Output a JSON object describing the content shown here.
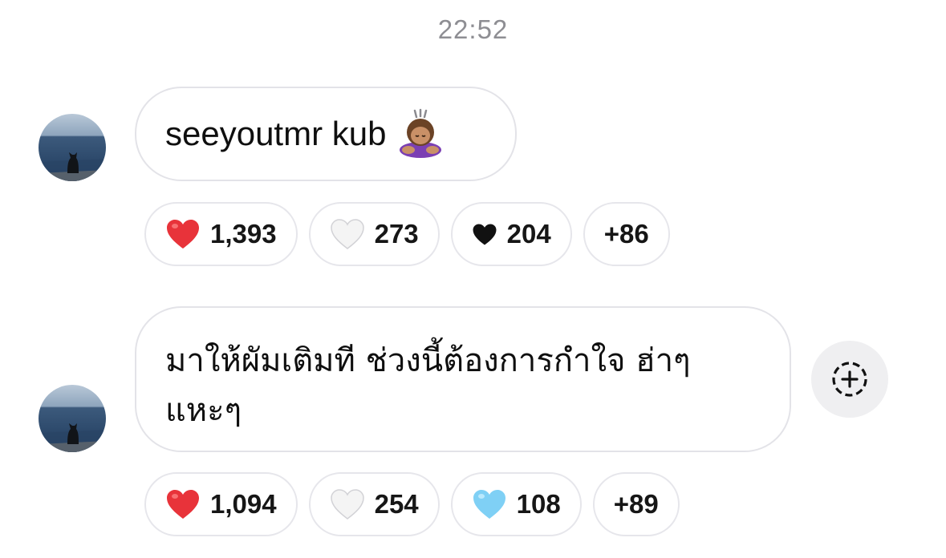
{
  "timestamp": "22:52",
  "colors": {
    "bubble_border": "#e3e3e8",
    "timestamp": "#8e8e93",
    "red_heart": "#e8333a",
    "white_heart": "#f2f2f2",
    "black_heart": "#111111",
    "blue_heart": "#7fd0f5"
  },
  "messages": [
    {
      "avatar": "cat-by-sea-avatar",
      "text": "seeyoutmr kub",
      "emoji": "person-bowing-emoji",
      "reactions": [
        {
          "icon": "red-heart-icon",
          "count": "1,393"
        },
        {
          "icon": "white-heart-icon",
          "count": "273"
        },
        {
          "icon": "black-heart-icon",
          "count": "204"
        },
        {
          "icon": "",
          "count": "+86"
        }
      ]
    },
    {
      "avatar": "cat-by-sea-avatar",
      "text": "มาให้ผัมเติมที ช่วงนี้ต้องการกำใจ ฮ่าๆ แหะๆ",
      "reactions": [
        {
          "icon": "red-heart-icon",
          "count": "1,094"
        },
        {
          "icon": "white-heart-icon",
          "count": "254"
        },
        {
          "icon": "blue-heart-icon",
          "count": "108"
        },
        {
          "icon": "",
          "count": "+89"
        }
      ],
      "action_icon": "add-reaction-icon"
    }
  ]
}
